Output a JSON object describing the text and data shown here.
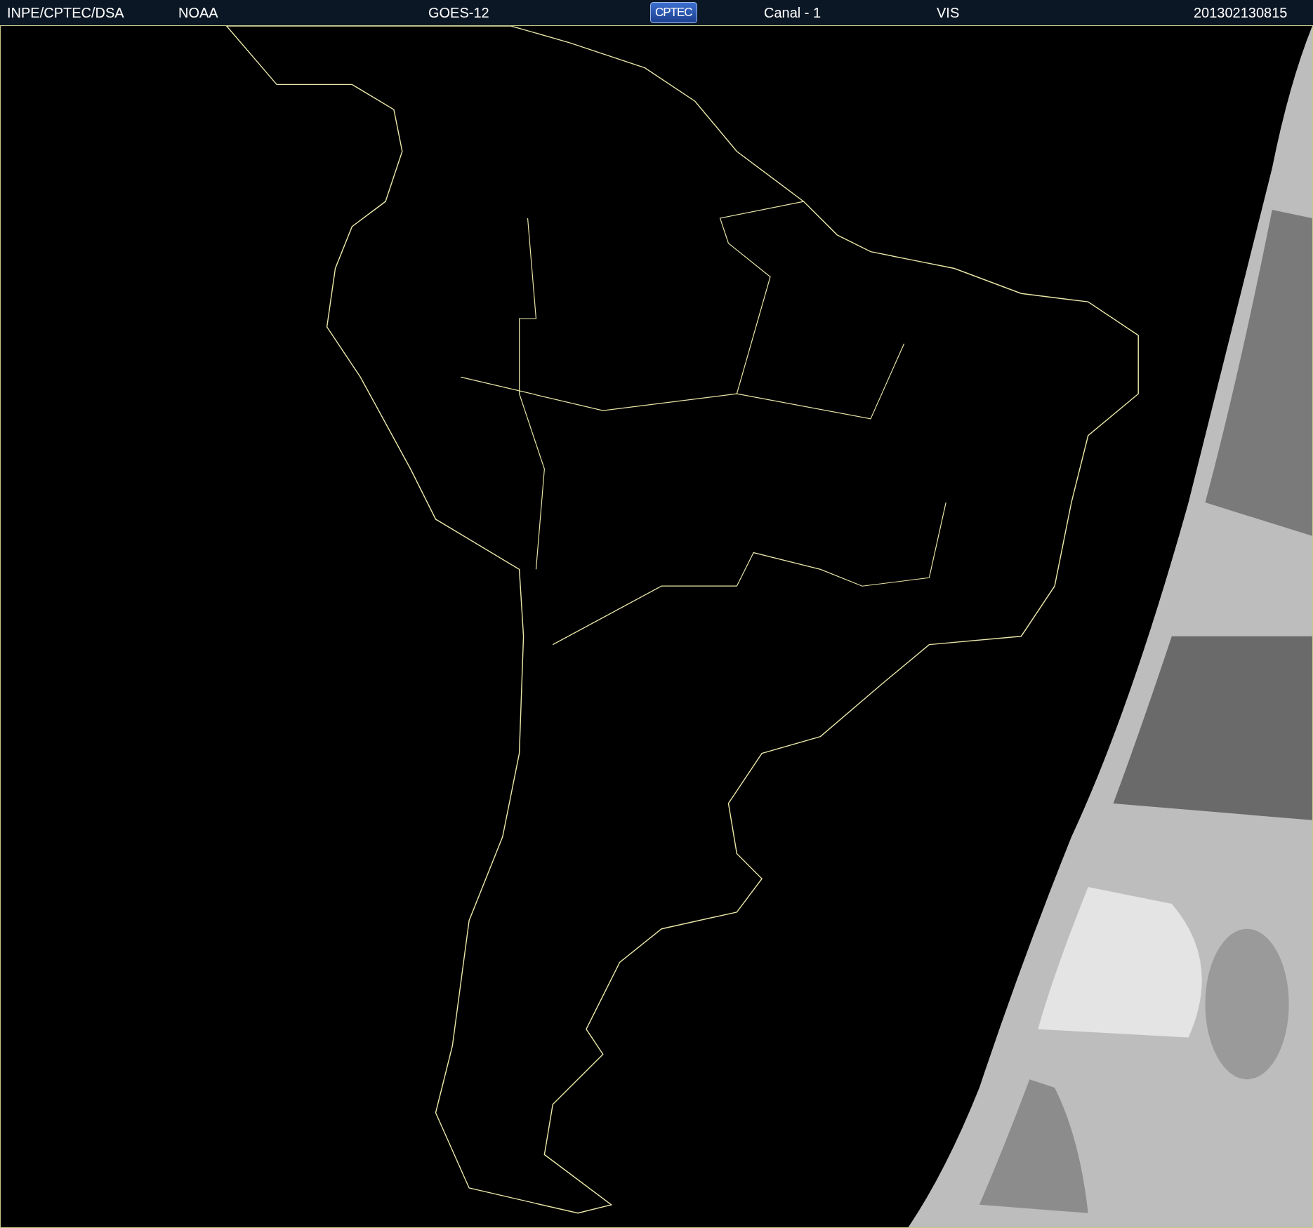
{
  "header": {
    "items": [
      {
        "kind": "text",
        "text": "INPE/CPTEC/DSA"
      },
      {
        "kind": "text",
        "text": "NOAA"
      },
      {
        "kind": "text",
        "text": "GOES-12"
      },
      {
        "kind": "logo",
        "text": "CPTEC"
      },
      {
        "kind": "text",
        "text": "Canal - 1"
      },
      {
        "kind": "text",
        "text": "VIS"
      },
      {
        "kind": "text",
        "text": "201302130815"
      }
    ]
  }
}
